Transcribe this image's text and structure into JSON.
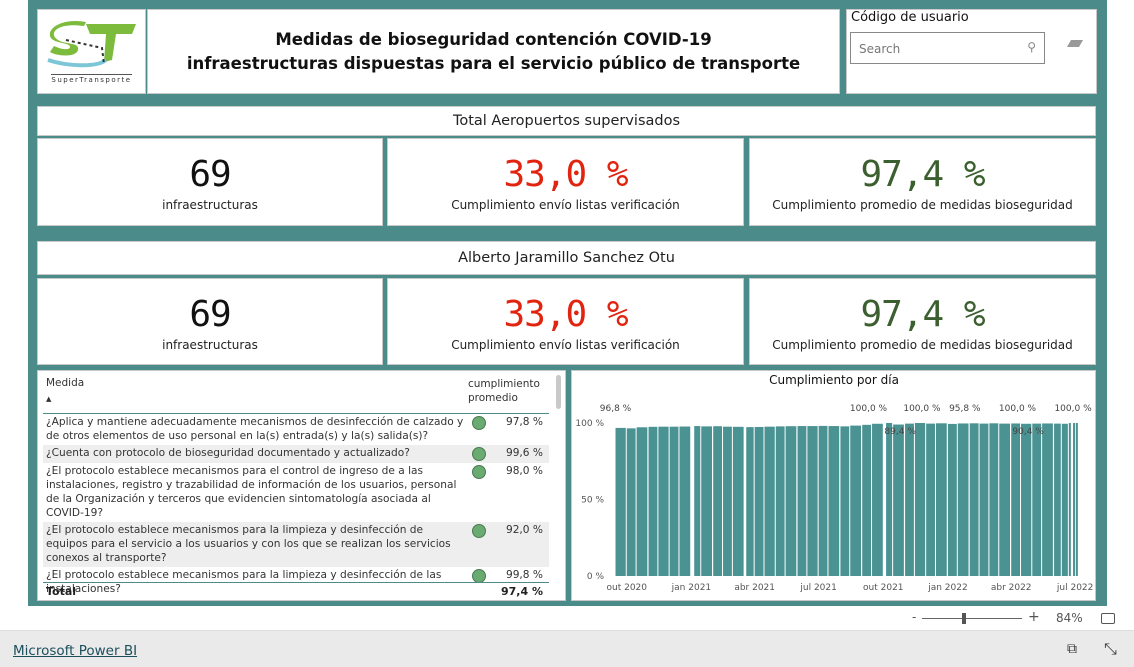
{
  "logo": {
    "text": "SuperTransporte",
    "mark": "ST"
  },
  "header": {
    "title_line1": "Medidas de bioseguridad contención COVID-19",
    "title_line2": "infraestructuras dispuestas para el servicio público de transporte"
  },
  "slicer": {
    "label": "Código de usuario",
    "placeholder": "Search",
    "search_icon": "magnifier",
    "clear_icon": "eraser"
  },
  "section1": {
    "title": "Total Aeropuertos  supervisados",
    "cards": [
      {
        "value": "69",
        "label": "infraestructuras"
      },
      {
        "value": "33,0 %",
        "label": "Cumplimiento envío listas verificación"
      },
      {
        "value": "97,4 %",
        "label": "Cumplimiento promedio de medidas bioseguridad"
      }
    ]
  },
  "section2": {
    "title": "Alberto Jaramillo Sanchez Otu",
    "cards": [
      {
        "value": "69",
        "label": "infraestructuras"
      },
      {
        "value": "33,0 %",
        "label": "Cumplimiento envío listas verificación"
      },
      {
        "value": "97,4 %",
        "label": "Cumplimiento promedio de medidas bioseguridad"
      }
    ]
  },
  "colors": {
    "canvas": "#4b8c8a",
    "red": "#e2230f",
    "green": "#3b5f2e",
    "bar": "#4b9292",
    "dot": "#6aab72"
  },
  "table": {
    "col_medida": "Medida",
    "col_cumplimiento": "cumplimiento promedio",
    "sort": "ascending",
    "rows": [
      {
        "medida": "¿Aplica y mantiene adecuadamente mecanismos de desinfección de calzado y de otros elementos de uso personal en la(s) entrada(s) y la(s) salida(s)?",
        "valor": "97,8 %"
      },
      {
        "medida": "¿Cuenta con protocolo de bioseguridad documentado y actualizado?",
        "valor": "99,6 %"
      },
      {
        "medida": "¿El protocolo establece mecanismos para el control de ingreso de a las instalaciones, registro y trazabilidad de información de los usuarios, personal de la Organización y terceros que evidencien sintomatología asociada al COVID-19?",
        "valor": "98,0 %"
      },
      {
        "medida": "¿El protocolo establece mecanismos para la limpieza y desinfección de equipos para el servicio a los usuarios y con los que se realizan los servicios conexos al transporte?",
        "valor": "92,0 %"
      },
      {
        "medida": "¿El protocolo establece mecanismos para la limpieza y desinfección de las instalaciones?",
        "valor": "99,8 %"
      }
    ],
    "total_label": "Total",
    "total_value": "97,4 %"
  },
  "chart_data": {
    "type": "bar",
    "title": "Cumplimiento por día",
    "ylim": [
      0,
      100
    ],
    "yticks": [
      "0 %",
      "50 %",
      "100 %"
    ],
    "xticks": [
      {
        "date": "2020-10-01",
        "label": "out 2020"
      },
      {
        "date": "2021-01-01",
        "label": "jan 2021"
      },
      {
        "date": "2021-04-01",
        "label": "abr 2021"
      },
      {
        "date": "2021-07-01",
        "label": "jul 2021"
      },
      {
        "date": "2021-10-01",
        "label": "out 2021"
      },
      {
        "date": "2022-01-01",
        "label": "jan 2022"
      },
      {
        "date": "2022-04-01",
        "label": "abr 2022"
      },
      {
        "date": "2022-07-01",
        "label": "jul 2022"
      }
    ],
    "xrange": [
      "2020-09-10",
      "2022-07-15"
    ],
    "points": [
      [
        "2020-09-15",
        96.8
      ],
      [
        "2020-10-01",
        96.5
      ],
      [
        "2020-10-15",
        97.2
      ],
      [
        "2020-11-01",
        97.5
      ],
      [
        "2020-11-15",
        97.6
      ],
      [
        "2020-12-01",
        97.6
      ],
      [
        "2020-12-15",
        97.7
      ],
      [
        "2021-01-05",
        98.0
      ],
      [
        "2021-01-15",
        97.8
      ],
      [
        "2021-02-01",
        97.9
      ],
      [
        "2021-02-15",
        97.6
      ],
      [
        "2021-03-01",
        97.5
      ],
      [
        "2021-03-20",
        97.3
      ],
      [
        "2021-04-01",
        97.4
      ],
      [
        "2021-04-15",
        97.6
      ],
      [
        "2021-05-01",
        97.8
      ],
      [
        "2021-05-15",
        97.9
      ],
      [
        "2021-06-01",
        98.0
      ],
      [
        "2021-06-15",
        98.0
      ],
      [
        "2021-07-01",
        98.1
      ],
      [
        "2021-07-15",
        98.0
      ],
      [
        "2021-08-01",
        97.8
      ],
      [
        "2021-08-15",
        98.3
      ],
      [
        "2021-09-01",
        98.8
      ],
      [
        "2021-09-15",
        99.5
      ],
      [
        "2021-10-05",
        100.0
      ],
      [
        "2021-10-15",
        99.0
      ],
      [
        "2021-11-01",
        99.6
      ],
      [
        "2021-11-15",
        100.0
      ],
      [
        "2021-12-01",
        99.6
      ],
      [
        "2021-12-15",
        99.8
      ],
      [
        "2022-01-01",
        99.4
      ],
      [
        "2022-01-15",
        99.7
      ],
      [
        "2022-02-01",
        99.8
      ],
      [
        "2022-02-15",
        99.6
      ],
      [
        "2022-03-01",
        99.8
      ],
      [
        "2022-03-15",
        99.6
      ],
      [
        "2022-04-01",
        99.7
      ],
      [
        "2022-04-15",
        99.5
      ],
      [
        "2022-05-01",
        99.6
      ],
      [
        "2022-05-15",
        99.7
      ],
      [
        "2022-06-01",
        99.6
      ],
      [
        "2022-06-12",
        99.5
      ],
      [
        "2022-06-22",
        100.0
      ],
      [
        "2022-06-28",
        100.0
      ],
      [
        "2022-07-02",
        100.0
      ]
    ],
    "data_labels": [
      {
        "date": "2020-09-15",
        "value": 96.8,
        "label": "96,8 %"
      },
      {
        "date": "2021-09-10",
        "value": 100.0,
        "label": "100,0 %"
      },
      {
        "date": "2021-10-25",
        "value": 89.4,
        "label": "89,4 %"
      },
      {
        "date": "2021-11-25",
        "value": 100.0,
        "label": "100,0 %"
      },
      {
        "date": "2022-01-25",
        "value": 95.8,
        "label": "95,8 %"
      },
      {
        "date": "2022-04-10",
        "value": 100.0,
        "label": "100,0 %"
      },
      {
        "date": "2022-04-25",
        "value": 90.4,
        "label": "90,4 %"
      },
      {
        "date": "2022-06-28",
        "value": 100.0,
        "label": "100,0 %"
      }
    ]
  },
  "zoom": {
    "minus": "-",
    "plus": "+",
    "level": "84%",
    "level_fraction": 0.84,
    "fit_icon": "fit-to-page"
  },
  "footer": {
    "link": "Microsoft Power BI",
    "share_icon": "share",
    "expand_icon": "expand"
  }
}
